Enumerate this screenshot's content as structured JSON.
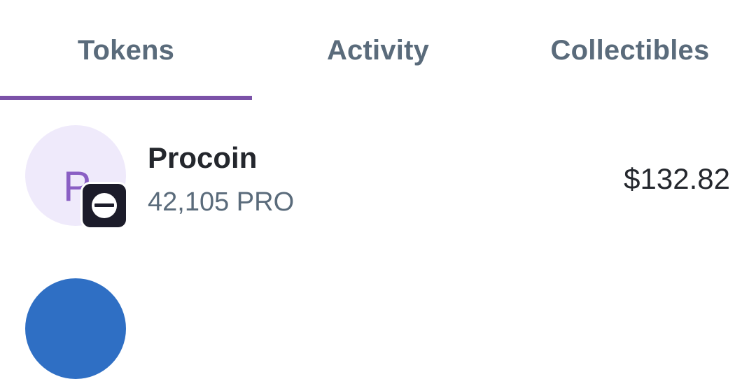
{
  "tabs": [
    {
      "label": "Tokens",
      "active": true
    },
    {
      "label": "Activity",
      "active": false
    },
    {
      "label": "Collectibles",
      "active": false
    }
  ],
  "colors": {
    "accent": "#7b52a8",
    "tab_text": "#5a6b7b",
    "primary_text": "#24272d",
    "avatar_bg": "#efeafb",
    "avatar_letter": "#8a5fc4",
    "badge_bg": "#1c1c2a",
    "next_avatar": "#2f6fc4"
  },
  "tokens": [
    {
      "avatar_letter": "P",
      "name": "Procoin",
      "amount": "42,105 PRO",
      "value": "$132.82",
      "network_icon": "network-badge-icon"
    }
  ]
}
